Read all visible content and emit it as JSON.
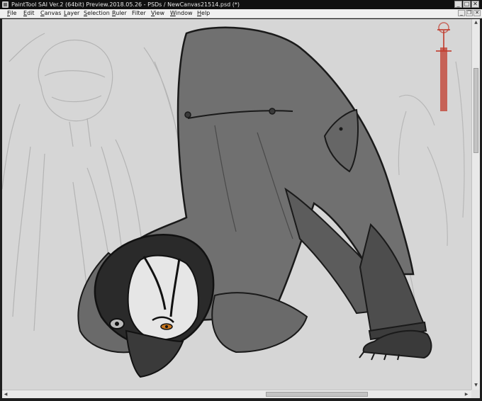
{
  "window": {
    "title": "PaintTool SAI Ver.2 (64bit) Preview.2018.05.26 - PSDs / NewCanvas21514.psd (*)",
    "controls": {
      "minimize": "_",
      "maximize": "□",
      "close": "✕"
    }
  },
  "menu": {
    "items": [
      {
        "label": "File",
        "accel": "F",
        "rest": "ile"
      },
      {
        "label": "Edit",
        "accel": "E",
        "rest": "dit"
      },
      {
        "label": "Canvas",
        "accel": "C",
        "rest": "anvas"
      },
      {
        "label": "Layer",
        "accel": "L",
        "rest": "ayer"
      },
      {
        "label": "Selection",
        "accel": "S",
        "rest": "election"
      },
      {
        "label": "Ruler",
        "accel": "R",
        "rest": "uler"
      },
      {
        "label": "Filter",
        "accel": "",
        "rest": "Filter"
      },
      {
        "label": "View",
        "accel": "V",
        "rest": "iew"
      },
      {
        "label": "Window",
        "accel": "W",
        "rest": "indow"
      },
      {
        "label": "Help",
        "accel": "H",
        "rest": "elp"
      }
    ],
    "doc_controls": {
      "minimize": "_",
      "restore": "❐",
      "close": "✕"
    }
  },
  "icons": {
    "app": "painttool-sai-icon",
    "scroll_up": "▲",
    "scroll_down": "▼",
    "scroll_left": "◀",
    "scroll_right": "▶"
  },
  "colors": {
    "canvas_bg": "#d6d6d6",
    "titlebar_bg": "#101010",
    "menubar_bg": "#f0f0f0",
    "lineart": "#1a1a1a",
    "coat": "#6e6e6e",
    "eye_accent": "#c8761e",
    "sketch_red": "#c0392b"
  }
}
